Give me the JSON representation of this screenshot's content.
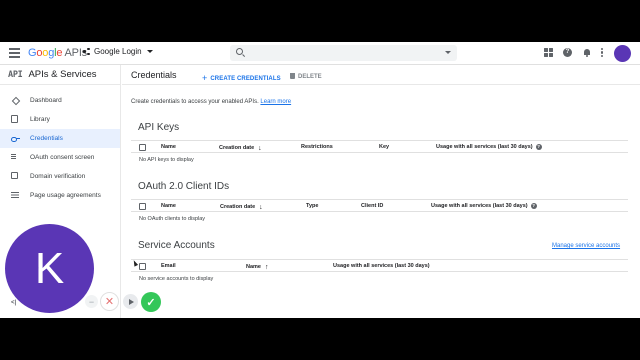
{
  "topbar": {
    "logo_google": [
      "G",
      "o",
      "o",
      "g",
      "l",
      "e"
    ],
    "logo_apis": "APIs",
    "project_name": "Google Login",
    "search_placeholder": ""
  },
  "sidebar": {
    "api_mark": "API",
    "title": "APIs & Services",
    "items": [
      {
        "label": "Dashboard",
        "icon": "dashboard-icon",
        "active": false
      },
      {
        "label": "Library",
        "icon": "library-icon",
        "active": false
      },
      {
        "label": "Credentials",
        "icon": "key-icon",
        "active": true
      },
      {
        "label": "OAuth consent screen",
        "icon": "consent-icon",
        "active": false
      },
      {
        "label": "Domain verification",
        "icon": "checkbox-icon",
        "active": false
      },
      {
        "label": "Page usage agreements",
        "icon": "settings-list-icon",
        "active": false
      }
    ],
    "collapse_label": "<|"
  },
  "main": {
    "title": "Credentials",
    "create_label": "CREATE CREDENTIALS",
    "delete_label": "DELETE",
    "intro_text": "Create credentials to access your enabled APIs.",
    "intro_link": "Learn more",
    "api_keys": {
      "title": "API Keys",
      "headers": [
        "Name",
        "Creation date",
        "Restrictions",
        "Key",
        "Usage with all services (last 30 days)"
      ],
      "empty": "No API keys to display"
    },
    "oauth": {
      "title": "OAuth 2.0 Client IDs",
      "headers": [
        "Name",
        "Creation date",
        "Type",
        "Client ID",
        "Usage with all services (last 30 days)"
      ],
      "empty": "No OAuth clients to display"
    },
    "service_accounts": {
      "title": "Service Accounts",
      "manage_link": "Manage service accounts",
      "headers": [
        "Email",
        "Name",
        "Usage with all services (last 30 days)"
      ],
      "empty": "No service accounts to display"
    }
  },
  "overlay": {
    "avatar_letter": "K",
    "avatar_color": "#5a36b5",
    "minus": "−",
    "close": "✕",
    "confirm": "✓"
  },
  "colors": {
    "accent": "#1a73e8",
    "active_bg": "#e8f0fe",
    "confirm_green": "#34c759"
  }
}
